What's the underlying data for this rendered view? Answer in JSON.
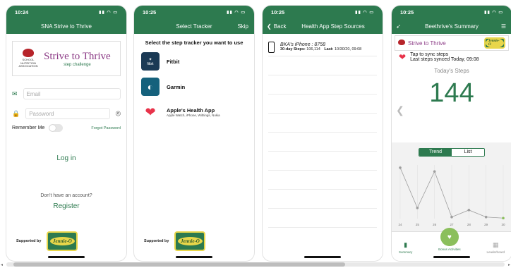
{
  "screens": [
    {
      "time": "10:24",
      "title": "SNA Strive to Thrive",
      "logo": {
        "org": "SCHOOL NUTRITION ASSOCIATION",
        "main": "Strive to Thrive",
        "sub": "step challenge"
      },
      "email_placeholder": "Email",
      "password_placeholder": "Password",
      "remember_label": "Remember Me",
      "forgot_label": "Forgot Password",
      "login_label": "Log in",
      "no_account": "Don't have an account?",
      "register_label": "Register",
      "supported_by": "Supported by",
      "sponsor": "Jennie-O"
    },
    {
      "time": "10:25",
      "title": "Select Tracker",
      "skip_label": "Skip",
      "prompt": "Select the step tracker you want to use",
      "trackers": [
        {
          "name": "Fitbit",
          "icon_text": "fitbit",
          "desc": ""
        },
        {
          "name": "Garmin",
          "icon_text": "",
          "desc": ""
        },
        {
          "name": "Apple's Health App",
          "icon_text": "",
          "desc": "Apple Watch, iPhone, Withings, Nokia"
        }
      ],
      "supported_by": "Supported by",
      "sponsor": "Jennie-O"
    },
    {
      "time": "10:25",
      "back_label": "Back",
      "title": "Health App Step Sources",
      "device": {
        "name": "BKA's iPhone : 8758",
        "steps_label": "30-day Steps:",
        "steps": "106,114",
        "last_label": "Last:",
        "last": "10/30/20, 09:08"
      }
    },
    {
      "time": "10:25",
      "title": "Beethrive's Summary",
      "sync_line1": "Tap to sync steps",
      "sync_line2": "Last steps synced Today, 09:08",
      "todays_label": "Today's Steps",
      "todays_steps": "144",
      "trend_label": "Trend",
      "list_label": "List",
      "tabs": [
        "Summary",
        "Bonus Activities",
        "Leaderboard"
      ]
    }
  ],
  "chart_data": {
    "type": "line",
    "x": [
      "24",
      "25",
      "26",
      "27",
      "28",
      "29",
      "30"
    ],
    "values": [
      95,
      20,
      88,
      3,
      16,
      3,
      1
    ],
    "ylim": [
      0,
      100
    ],
    "color": "#9e9e9e"
  },
  "colors": {
    "brand": "#2d7a4f",
    "accent": "#8c3b86",
    "heart": "#e8334a"
  }
}
